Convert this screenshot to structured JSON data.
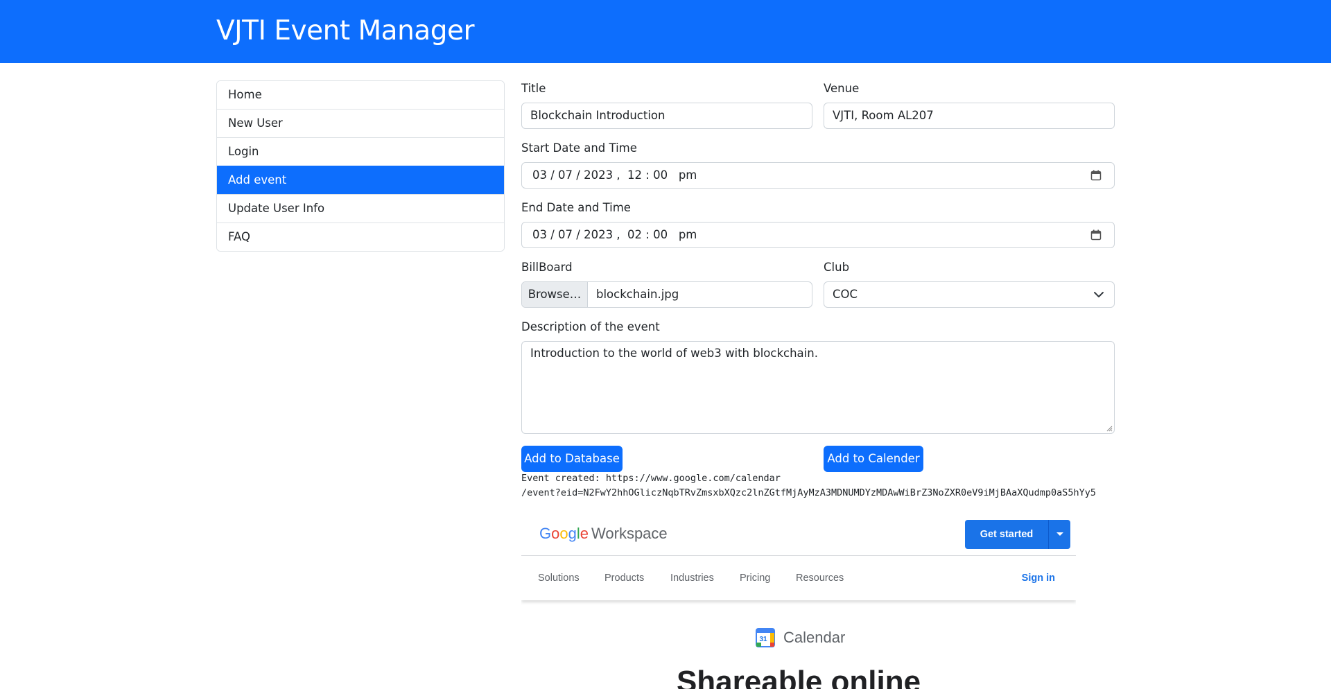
{
  "app": {
    "title": "VJTI Event Manager"
  },
  "sidebar": {
    "items": [
      {
        "label": "Home"
      },
      {
        "label": "New User"
      },
      {
        "label": "Login"
      },
      {
        "label": "Add event"
      },
      {
        "label": "Update User Info"
      },
      {
        "label": "FAQ"
      }
    ]
  },
  "form": {
    "title_label": "Title",
    "title_value": "Blockchain Introduction",
    "venue_label": "Venue",
    "venue_value": "VJTI, Room AL207",
    "start_label": "Start Date and Time",
    "start_value": "03 / 07 / 2023 ,  12 : 00   pm",
    "end_label": "End Date and Time",
    "end_value": "03 / 07 / 2023 ,  02 : 00   pm",
    "billboard_label": "BillBoard",
    "browse_label": "Browse…",
    "file_name": "blockchain.jpg",
    "club_label": "Club",
    "club_value": "COC",
    "description_label": "Description of the event",
    "description_value": "Introduction to the world of web3 with blockchain.",
    "add_db_button": "Add to Database",
    "add_cal_button": "Add to Calender"
  },
  "result": {
    "line1": "Event created: https://www.google.com/calendar",
    "line2": "/event?eid=N2FwY2hhOGliczNqbTRvZmsxbXQzc2lnZGtfMjAyMzA3MDNUMDYzMDAwWiBrZ3NoZXR0eV9iMjBAaXQudmp0aS5hYy5"
  },
  "google_workspace": {
    "logo_google": "Google",
    "logo_workspace": "Workspace",
    "cta": "Get started",
    "nav": [
      "Solutions",
      "Products",
      "Industries",
      "Pricing",
      "Resources"
    ],
    "sign_in": "Sign in",
    "product": "Calendar",
    "calendar_day": "31",
    "hero": "Shareable online"
  },
  "colors": {
    "primary": "#0d6efd",
    "google_blue": "#1a73e8"
  }
}
